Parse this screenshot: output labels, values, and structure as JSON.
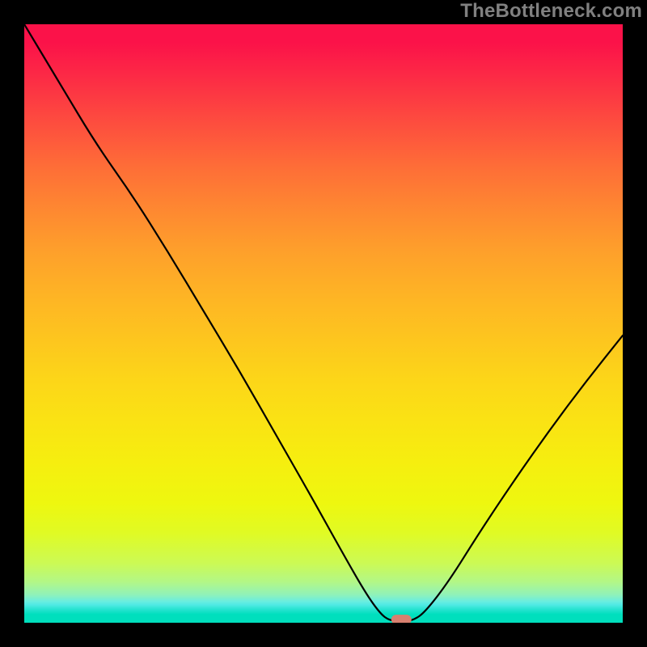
{
  "watermark": "TheBottleneck.com",
  "chart_data": {
    "type": "line",
    "title": "",
    "subtitle": "",
    "xlabel": "",
    "ylabel": "",
    "xlim": [
      0,
      100
    ],
    "ylim": [
      0,
      100
    ],
    "grid": false,
    "series": [
      {
        "name": "bottleneck-curve",
        "description": "V-shaped curve; y ~ bottleneck percentage; minimum near x≈63 at y≈0",
        "points": [
          {
            "x": 0.0,
            "y": 100.0
          },
          {
            "x": 6.0,
            "y": 90.0
          },
          {
            "x": 12.0,
            "y": 80.0
          },
          {
            "x": 18.0,
            "y": 71.5
          },
          {
            "x": 24.0,
            "y": 62.0
          },
          {
            "x": 30.0,
            "y": 52.0
          },
          {
            "x": 36.0,
            "y": 42.0
          },
          {
            "x": 42.0,
            "y": 31.5
          },
          {
            "x": 48.0,
            "y": 21.0
          },
          {
            "x": 53.0,
            "y": 12.0
          },
          {
            "x": 57.0,
            "y": 5.0
          },
          {
            "x": 59.5,
            "y": 1.5
          },
          {
            "x": 61.0,
            "y": 0.4
          },
          {
            "x": 63.0,
            "y": 0.2
          },
          {
            "x": 65.0,
            "y": 0.4
          },
          {
            "x": 67.0,
            "y": 1.8
          },
          {
            "x": 71.0,
            "y": 7.0
          },
          {
            "x": 76.0,
            "y": 15.0
          },
          {
            "x": 82.0,
            "y": 24.0
          },
          {
            "x": 88.0,
            "y": 32.5
          },
          {
            "x": 94.0,
            "y": 40.5
          },
          {
            "x": 100.0,
            "y": 48.0
          }
        ]
      }
    ],
    "annotations": [
      {
        "name": "optimum-marker",
        "shape": "rounded-rect",
        "color": "#d8806f",
        "x": 63.0,
        "y": 0.5,
        "width_pct": 3.3,
        "height_pct": 1.6
      }
    ],
    "background_gradient": {
      "type": "vertical",
      "stops": [
        {
          "pos": 0.0,
          "color": "#fb1249"
        },
        {
          "pos": 0.5,
          "color": "#fdc41f"
        },
        {
          "pos": 0.8,
          "color": "#eef70f"
        },
        {
          "pos": 0.95,
          "color": "#90f2b9"
        },
        {
          "pos": 1.0,
          "color": "#00dfbd"
        }
      ]
    }
  },
  "colors": {
    "frame": "#000000",
    "curve": "#000000",
    "marker": "#d8806f",
    "watermark": "#808080"
  }
}
